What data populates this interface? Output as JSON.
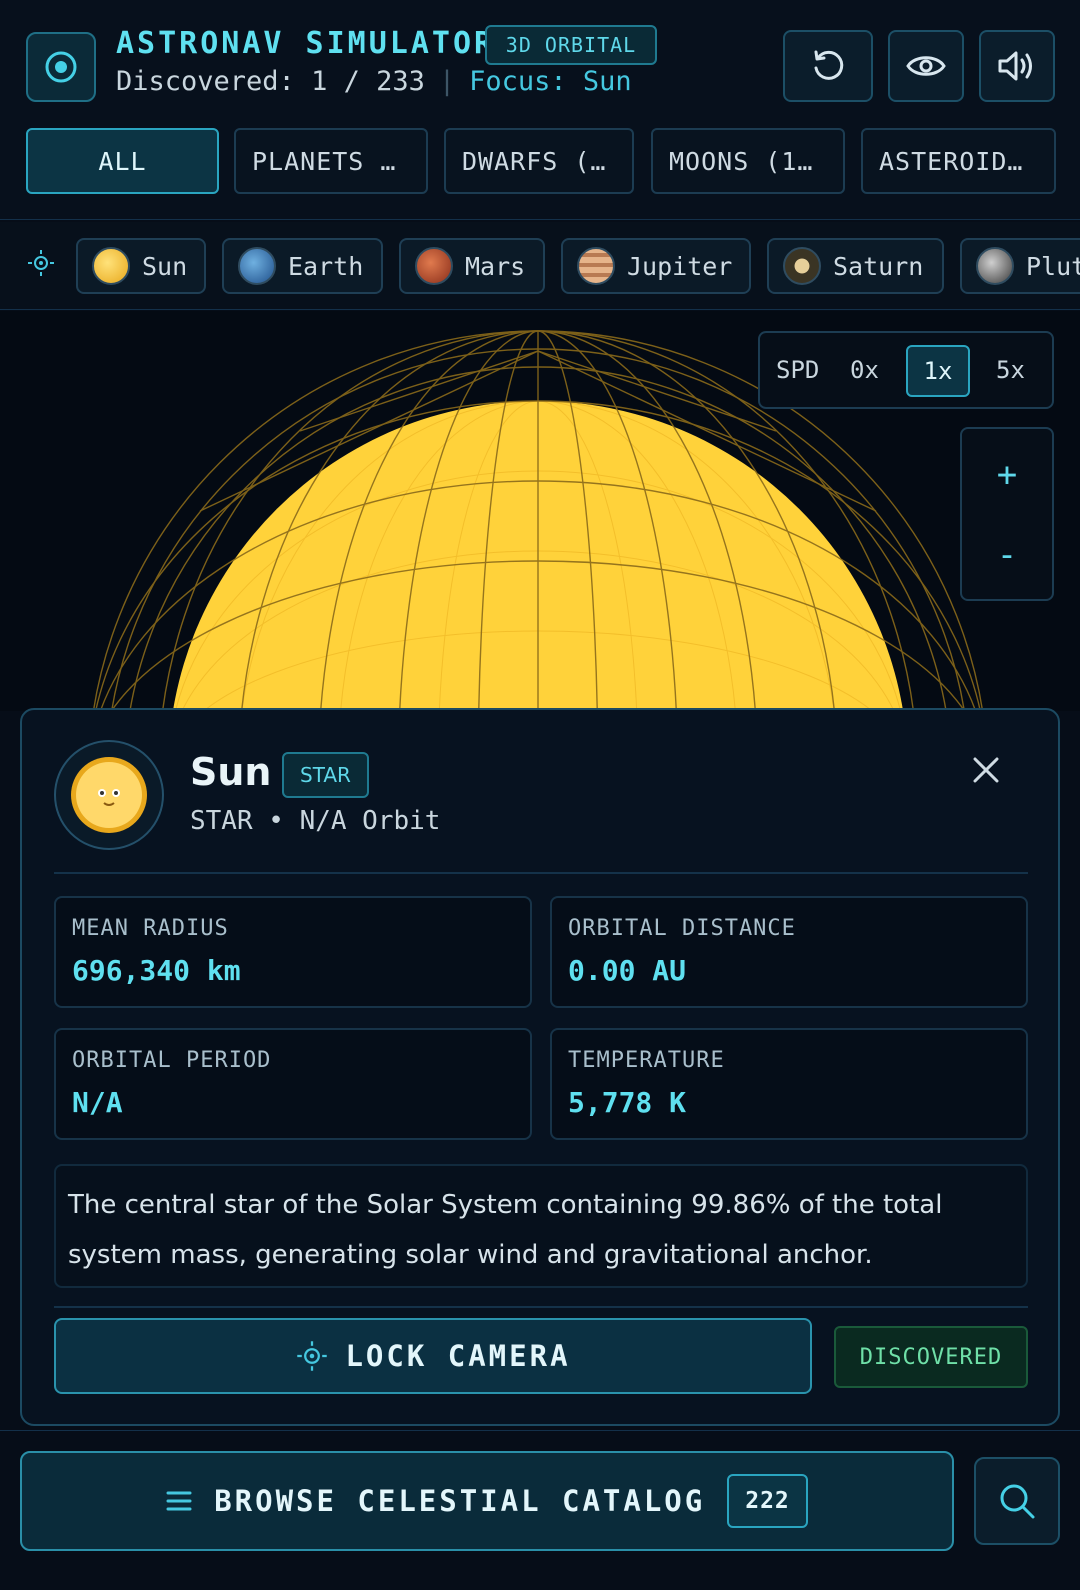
{
  "header": {
    "title": "ASTRONAV SIMULATOR",
    "mode_badge": "3D ORBITAL",
    "discovered_label": "Discovered: 1 / 233",
    "separator": "|",
    "focus_label": "Focus: Sun"
  },
  "tabs": [
    {
      "label": "ALL",
      "active": true
    },
    {
      "label": "PLANETS …",
      "active": false
    },
    {
      "label": "DWARFS (…",
      "active": false
    },
    {
      "label": "MOONS (1…",
      "active": false
    },
    {
      "label": "ASTEROID…",
      "active": false
    }
  ],
  "quick_objects": [
    {
      "label": "Sun",
      "color": "#f2c33a"
    },
    {
      "label": "Earth",
      "color": "#3a7ab8"
    },
    {
      "label": "Mars",
      "color": "#c4542e"
    },
    {
      "label": "Jupiter",
      "color": "#d39a6a"
    },
    {
      "label": "Saturn",
      "color": "#c8b48a"
    },
    {
      "label": "Plut",
      "color": "#8a8a8a"
    }
  ],
  "speed": {
    "label": "SPD",
    "options": [
      "0x",
      "1x",
      "5x"
    ],
    "selected": "1x"
  },
  "zoom": {
    "in": "+",
    "out": "-"
  },
  "object": {
    "name": "Sun",
    "badge": "STAR",
    "subtitle": "STAR • N/A Orbit",
    "stats": [
      {
        "label": "MEAN RADIUS",
        "value": "696,340 km"
      },
      {
        "label": "ORBITAL DISTANCE",
        "value": "0.00 AU"
      },
      {
        "label": "ORBITAL PERIOD",
        "value": "N/A"
      },
      {
        "label": "TEMPERATURE",
        "value": "5,778 K"
      }
    ],
    "description": "The central star of the Solar System containing 99.86% of the total system mass, generating solar wind and gravitational anchor.",
    "lock_label": "LOCK CAMERA",
    "status": "DISCOVERED"
  },
  "bottom": {
    "browse_label": "BROWSE CELESTIAL CATALOG",
    "count": "222"
  },
  "colors": {
    "accent": "#5fe0f0",
    "sun": "#ffd23a",
    "wireframe": "#8a6a1a",
    "success": "#6fe0a8"
  }
}
